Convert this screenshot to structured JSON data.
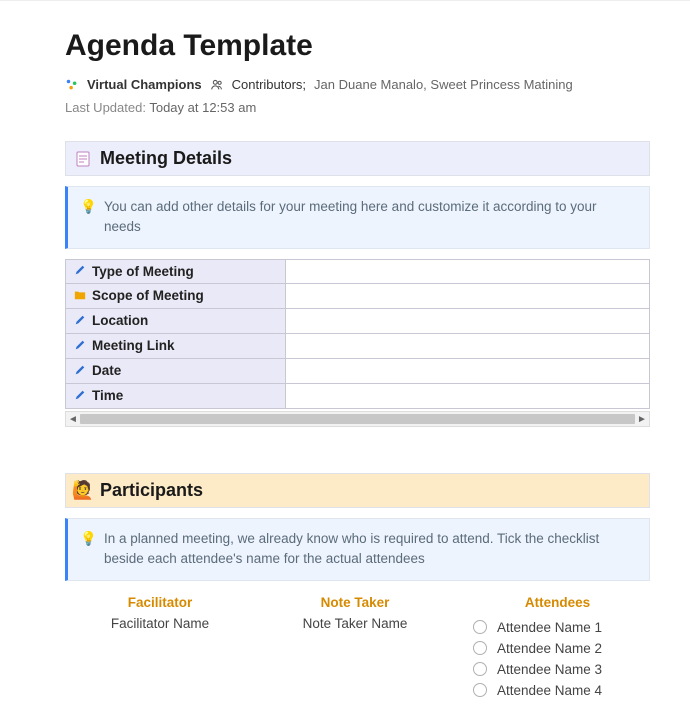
{
  "title": "Agenda Template",
  "meta": {
    "workspace": "Virtual Champions",
    "contributors_label": "Contributors;",
    "contributors_names": "Jan Duane Manalo, Sweet Princess Matining",
    "updated_label": "Last Updated:",
    "updated_value": "Today at 12:53 am"
  },
  "sections": {
    "details": {
      "heading": "Meeting Details",
      "callout": "You can add other details for your meeting here and customize it according to your needs",
      "rows": [
        {
          "icon": "pencil",
          "label": "Type of Meeting",
          "value": ""
        },
        {
          "icon": "folder",
          "label": "Scope of Meeting",
          "value": ""
        },
        {
          "icon": "pencil",
          "label": "Location",
          "value": ""
        },
        {
          "icon": "pencil",
          "label": "Meeting Link",
          "value": ""
        },
        {
          "icon": "pencil",
          "label": "Date",
          "value": ""
        },
        {
          "icon": "pencil",
          "label": "Time",
          "value": ""
        }
      ]
    },
    "participants": {
      "heading": "Participants",
      "callout": "In a planned meeting, we already know who is required to attend. Tick the checklist beside each attendee's name for the actual attendees",
      "roles": {
        "facilitator": {
          "title": "Facilitator",
          "value": "Facilitator Name"
        },
        "notetaker": {
          "title": "Note Taker",
          "value": "Note Taker Name"
        },
        "attendees": {
          "title": "Attendees",
          "items": [
            "Attendee Name 1",
            "Attendee Name 2",
            "Attendee Name 3",
            "Attendee Name 4"
          ]
        }
      }
    }
  }
}
